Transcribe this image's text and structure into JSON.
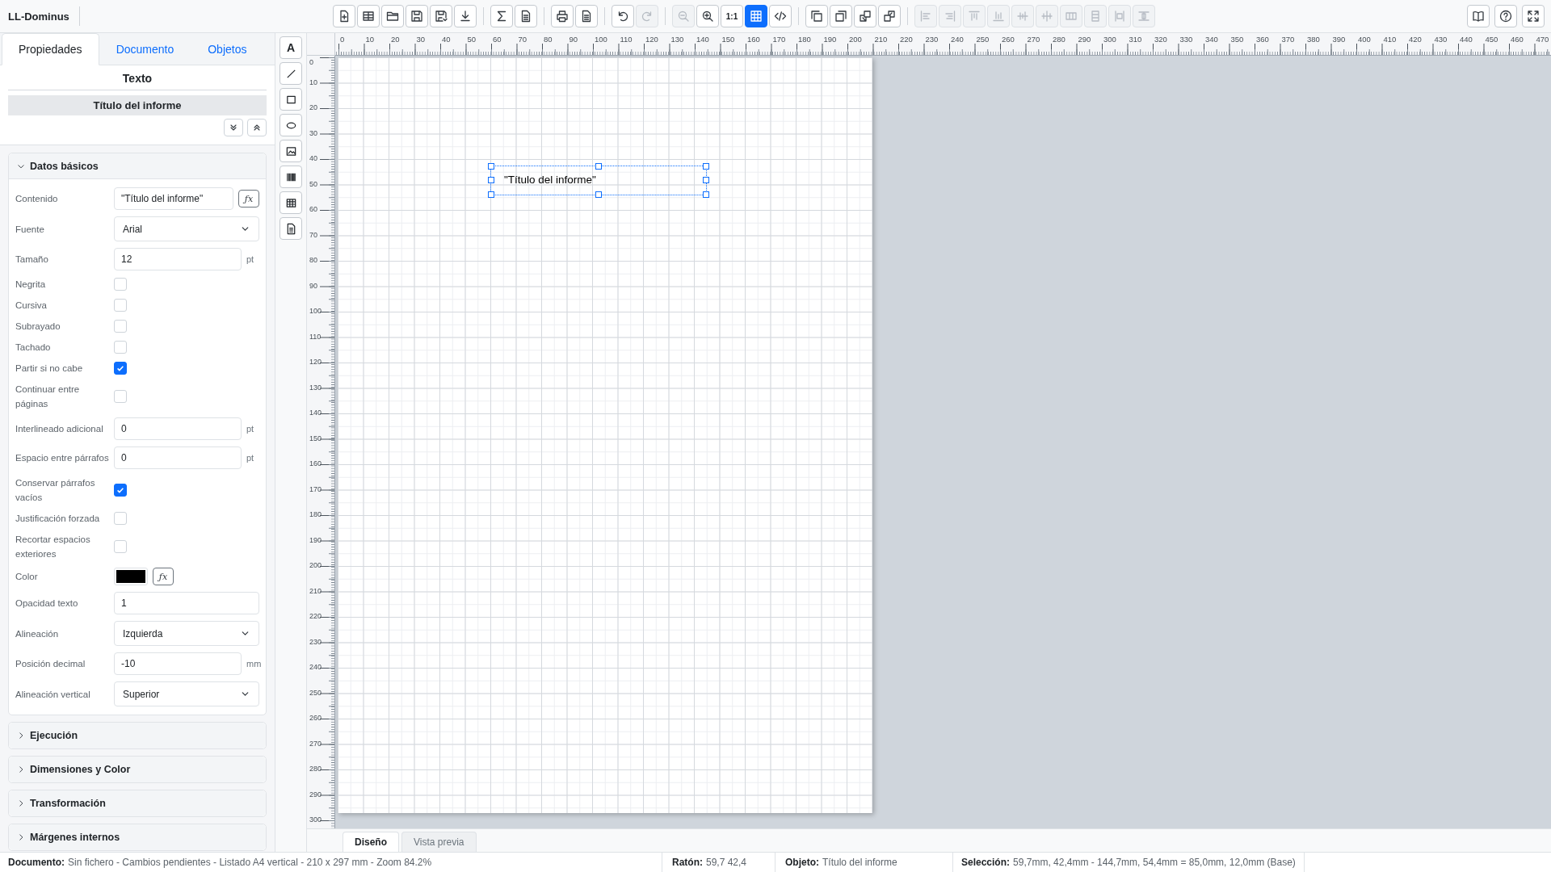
{
  "app": {
    "title": "LL-Dominus"
  },
  "toolbar": [
    [
      {
        "disabled": false,
        "selected": false
      },
      {
        "disabled": false,
        "selected": false
      },
      {
        "disabled": false,
        "selected": false
      },
      {
        "disabled": false,
        "selected": false
      },
      {
        "disabled": false,
        "selected": false
      },
      {
        "disabled": false,
        "selected": false
      }
    ],
    [
      {
        "disabled": false,
        "selected": false
      },
      {
        "disabled": false,
        "selected": false
      }
    ],
    [
      {
        "disabled": false,
        "selected": false
      },
      {
        "disabled": false,
        "selected": false
      }
    ],
    [
      {
        "disabled": false,
        "selected": false
      },
      {
        "disabled": true,
        "selected": false
      }
    ],
    [
      {
        "disabled": true,
        "selected": false
      },
      {
        "disabled": false,
        "selected": false
      },
      {
        "label": "1:1",
        "disabled": false,
        "selected": false
      },
      {
        "disabled": false,
        "selected": true
      },
      {
        "disabled": false,
        "selected": false
      }
    ],
    [
      {
        "disabled": false,
        "selected": false
      },
      {
        "disabled": false,
        "selected": false
      },
      {
        "disabled": false,
        "selected": false
      },
      {
        "disabled": false,
        "selected": false
      }
    ],
    [
      {
        "disabled": true,
        "selected": false
      },
      {
        "disabled": true,
        "selected": false
      },
      {
        "disabled": true,
        "selected": false
      },
      {
        "disabled": true,
        "selected": false
      },
      {
        "disabled": true,
        "selected": false
      },
      {
        "disabled": true,
        "selected": false
      },
      {
        "disabled": true,
        "selected": false
      },
      {
        "disabled": true,
        "selected": false
      },
      {
        "disabled": true,
        "selected": false
      },
      {
        "disabled": true,
        "selected": false
      }
    ]
  ],
  "toolbar_right": [
    {
      "disabled": false,
      "selected": false
    },
    {
      "disabled": false,
      "selected": false
    },
    {
      "disabled": false,
      "selected": false
    }
  ],
  "panel_tabs": [
    {
      "label": "Propiedades",
      "selected": true
    },
    {
      "label": "Documento",
      "selected": false
    },
    {
      "label": "Objetos",
      "selected": false
    }
  ],
  "object_type": "Texto",
  "object_name": "Título del informe",
  "sections": [
    {
      "title": "Datos básicos",
      "expanded": true,
      "rows": [
        {
          "kind": "text",
          "label": "Contenido",
          "value": "\"Título del informe\"",
          "fx": "ƒx"
        },
        {
          "kind": "select",
          "label": "Fuente",
          "value": "Arial"
        },
        {
          "kind": "text",
          "label": "Tamaño",
          "value": "12",
          "unit": "pt"
        },
        {
          "kind": "checkbox",
          "label": "Negrita",
          "checked": false
        },
        {
          "kind": "checkbox",
          "label": "Cursiva",
          "checked": false
        },
        {
          "kind": "checkbox",
          "label": "Subrayado",
          "checked": false
        },
        {
          "kind": "checkbox",
          "label": "Tachado",
          "checked": false
        },
        {
          "kind": "checkbox",
          "label": "Partir si no cabe",
          "checked": true
        },
        {
          "kind": "checkbox",
          "label": "Continuar entre páginas",
          "checked": false
        },
        {
          "kind": "text",
          "label": "Interlineado adicional",
          "value": "0",
          "unit": "pt"
        },
        {
          "kind": "text",
          "label": "Espacio entre párrafos",
          "value": "0",
          "unit": "pt"
        },
        {
          "kind": "checkbox",
          "label": "Conservar párrafos vacíos",
          "checked": true
        },
        {
          "kind": "checkbox",
          "label": "Justificación forzada",
          "checked": false
        },
        {
          "kind": "checkbox",
          "label": "Recortar espacios exteriores",
          "checked": false
        },
        {
          "kind": "color",
          "label": "Color",
          "color": "#000000",
          "fx": "ƒx"
        },
        {
          "kind": "text",
          "label": "Opacidad texto",
          "value": "1"
        },
        {
          "kind": "select",
          "label": "Alineación",
          "value": "Izquierda"
        },
        {
          "kind": "text",
          "label": "Posición decimal",
          "value": "-10",
          "unit": "mm"
        },
        {
          "kind": "select",
          "label": "Alineación vertical",
          "value": "Superior"
        }
      ]
    },
    {
      "title": "Ejecución",
      "expanded": false
    },
    {
      "title": "Dimensiones y Color",
      "expanded": false
    },
    {
      "title": "Transformación",
      "expanded": false
    },
    {
      "title": "Márgenes internos",
      "expanded": false
    }
  ],
  "tools": [
    {
      "kind": "text",
      "glyph": "A"
    },
    {
      "kind": "line"
    },
    {
      "kind": "rectangle"
    },
    {
      "kind": "ellipse"
    },
    {
      "kind": "image"
    },
    {
      "kind": "barcode"
    },
    {
      "kind": "table"
    },
    {
      "kind": "document"
    }
  ],
  "ruler_horizontal": [
    "0",
    "10",
    "20",
    "30",
    "40",
    "50",
    "60",
    "70",
    "80",
    "90",
    "100",
    "110",
    "120",
    "130",
    "140",
    "150",
    "160",
    "170",
    "180",
    "190",
    "200",
    "210",
    "220",
    "230",
    "240",
    "250",
    "260",
    "270",
    "280",
    "290",
    "300",
    "310",
    "320",
    "330",
    "340",
    "350",
    "360",
    "370",
    "380",
    "390",
    "400",
    "410",
    "420",
    "430",
    "440",
    "450",
    "460",
    "470"
  ],
  "ruler_vertical": [
    "0",
    "10",
    "20",
    "30",
    "40",
    "50",
    "60",
    "70",
    "80",
    "90",
    "100",
    "110",
    "120",
    "130",
    "140",
    "150",
    "160",
    "170",
    "180",
    "190",
    "200",
    "210",
    "220",
    "230",
    "240",
    "250",
    "260",
    "270",
    "280",
    "290",
    "300"
  ],
  "canvas_objects": [
    {
      "kind": "text",
      "content": "\"Título del informe\"",
      "selected": true
    }
  ],
  "view_tabs": [
    {
      "label": "Diseño",
      "selected": true
    },
    {
      "label": "Vista previa",
      "selected": false
    }
  ],
  "status_bar": [
    {
      "label": "Documento:",
      "value": "Sin fichero - Cambios pendientes - Listado A4 vertical - 210 x 297 mm - Zoom 84.2%"
    },
    {
      "label": "Ratón:",
      "value": "59,7 42,4"
    },
    {
      "label": "Objeto:",
      "value": "Título del informe"
    },
    {
      "label": "Selección:",
      "value": "59,7mm, 42,4mm - 144,7mm, 54,4mm = 85,0mm, 12,0mm (Base)"
    }
  ]
}
